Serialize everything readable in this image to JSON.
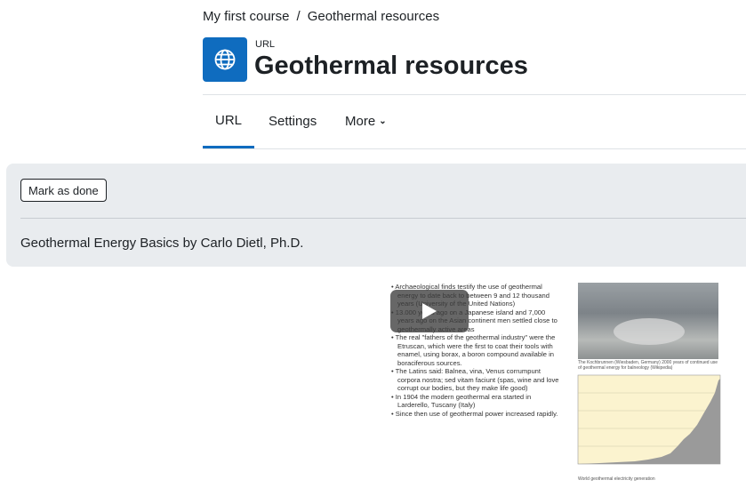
{
  "breadcrumb": {
    "course": "My first course",
    "separator": "/",
    "current": "Geothermal resources"
  },
  "header": {
    "activity_type": "URL",
    "title": "Geothermal resources",
    "icon": "globe-icon"
  },
  "tabs": [
    {
      "label": "URL",
      "active": true
    },
    {
      "label": "Settings",
      "active": false
    },
    {
      "label": "More",
      "active": false,
      "icon": "chevron-down-icon"
    }
  ],
  "activity": {
    "mark_done_label": "Mark as done",
    "description": "Geothermal Energy Basics by Carlo Dietl, Ph.D."
  },
  "video": {
    "bullets": [
      "Archaeological finds testify the use of geothermal energy to date back to between 9 and 12 thousand years (University of the United Nations)",
      "13.000 years ago on a Japanese island and 7,000 years ago on the Asian continent men settled close to geothermally active areas",
      "The real \"fathers of the geothermal industry\" were the Etruscan, which were the first to coat their tools with enamel, using borax, a boron compound available in boraciferous sources.",
      "The Latins said: Balnea, vina, Venus corrumpunt corpora nostra; sed vitam faciunt (spas, wine and love corrupt our bodies, but they make life good)",
      "In 1904 the modern geothermal era started in Larderello, Tuscany (Italy)",
      "Since then use of geothermal power increased rapidly."
    ],
    "photo_caption": "The Kochbrunnen (Wiesbaden, Germany) 2000 years of continued use of geothermal energy for balneology (Wikipedia)",
    "chart_caption": "World geothermal electricity generation",
    "play_icon": "play-icon",
    "colors": {
      "chart_fill": "#9a9a9a",
      "chart_bg": "#fbf3cf"
    }
  }
}
